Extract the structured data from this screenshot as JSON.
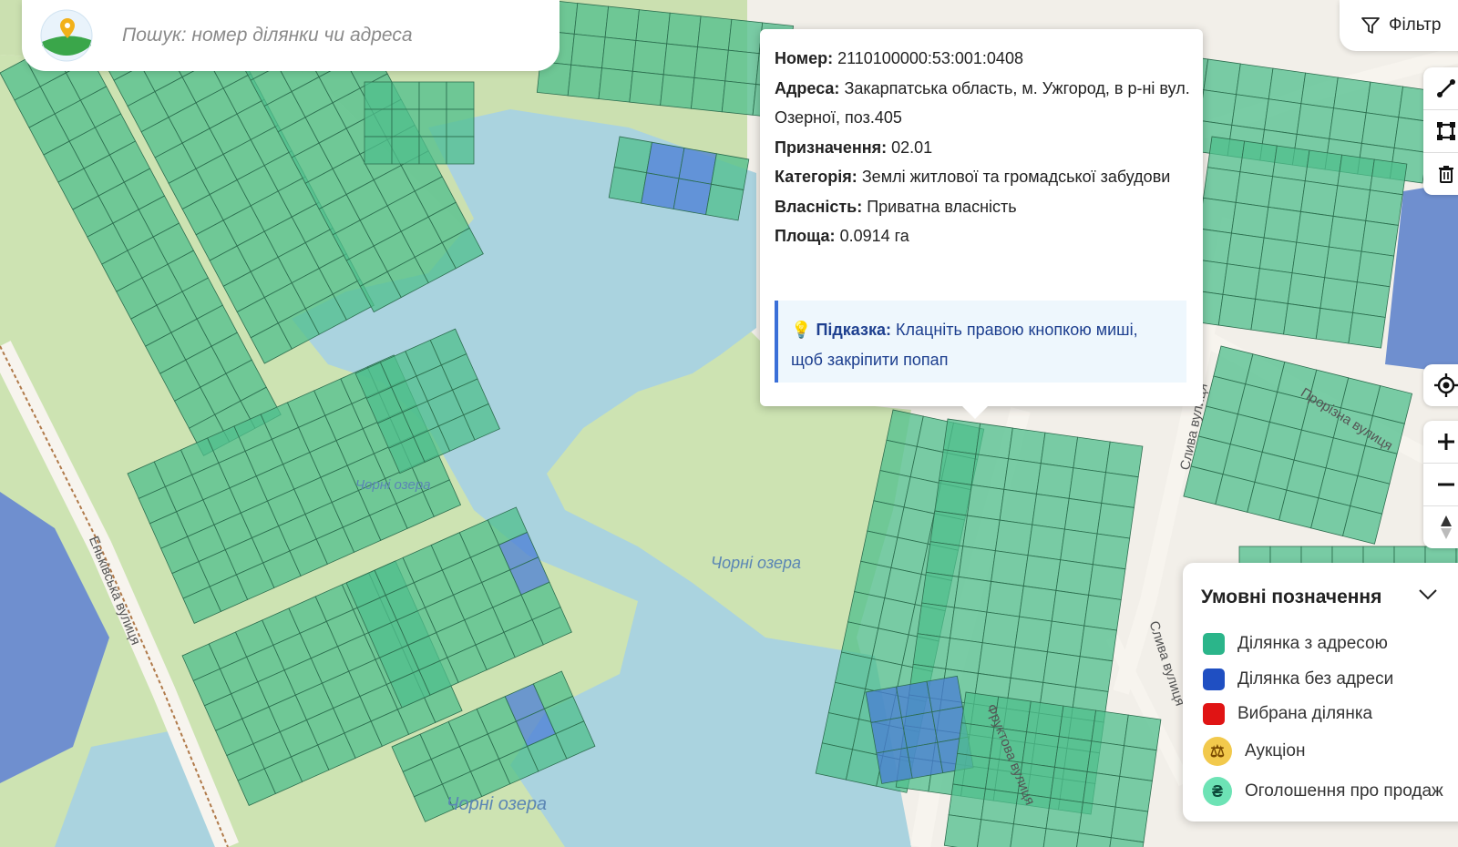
{
  "search": {
    "placeholder": "Пошук: номер ділянки чи адреса"
  },
  "filter": {
    "label": "Фільтр"
  },
  "toolbar": {
    "draw": [
      "ruler-icon",
      "polygon-icon",
      "trash-icon"
    ],
    "nav": [
      "locate-icon",
      "zoom-in-icon",
      "zoom-out-icon",
      "compass-icon"
    ]
  },
  "popup": {
    "rows": [
      {
        "key": "Номер:",
        "value": "2110100000:53:001:0408"
      },
      {
        "key": "Адреса:",
        "value": "Закарпатська область, м. Ужгород, в р-ні вул. Озерної, поз.405"
      },
      {
        "key": "Призначення:",
        "value": "02.01"
      },
      {
        "key": "Категорія:",
        "value": "Землі житлової та громадської забудови"
      },
      {
        "key": "Власність:",
        "value": "Приватна власність"
      },
      {
        "key": "Площа:",
        "value": "0.0914 га"
      }
    ],
    "hint_label": "Підказка:",
    "hint_text": "Клацніть правою кнопкою миші, щоб закріпити попап"
  },
  "legend": {
    "title": "Умовні позначення",
    "items": [
      {
        "label": "Ділянка з адресою",
        "color": "#2bb58a"
      },
      {
        "label": "Ділянка без адреси",
        "color": "#1f4fc2"
      },
      {
        "label": "Вибрана ділянка",
        "color": "#e01414"
      },
      {
        "label": "Аукціон",
        "color": "#f2c94c"
      },
      {
        "label": "Оголошення про продаж",
        "color": "#6de3b5"
      }
    ]
  },
  "map_labels": {
    "lake_1": "Чорні озера",
    "lake_2": "Чорні озера",
    "lake_3": "Чорні озера",
    "street_1": "Еньківська вулиця",
    "street_2": "Слива вулиця",
    "street_3": "Слива вулиця",
    "street_4": "Фруктова вулиця",
    "street_5": "Прорізна вулиця"
  },
  "colors": {
    "water": "#aad3df",
    "park": "#c8dfa8",
    "parcel_address": "#4fbf8c",
    "parcel_no_address": "#4a7dd6",
    "road": "#f7f6f2"
  }
}
